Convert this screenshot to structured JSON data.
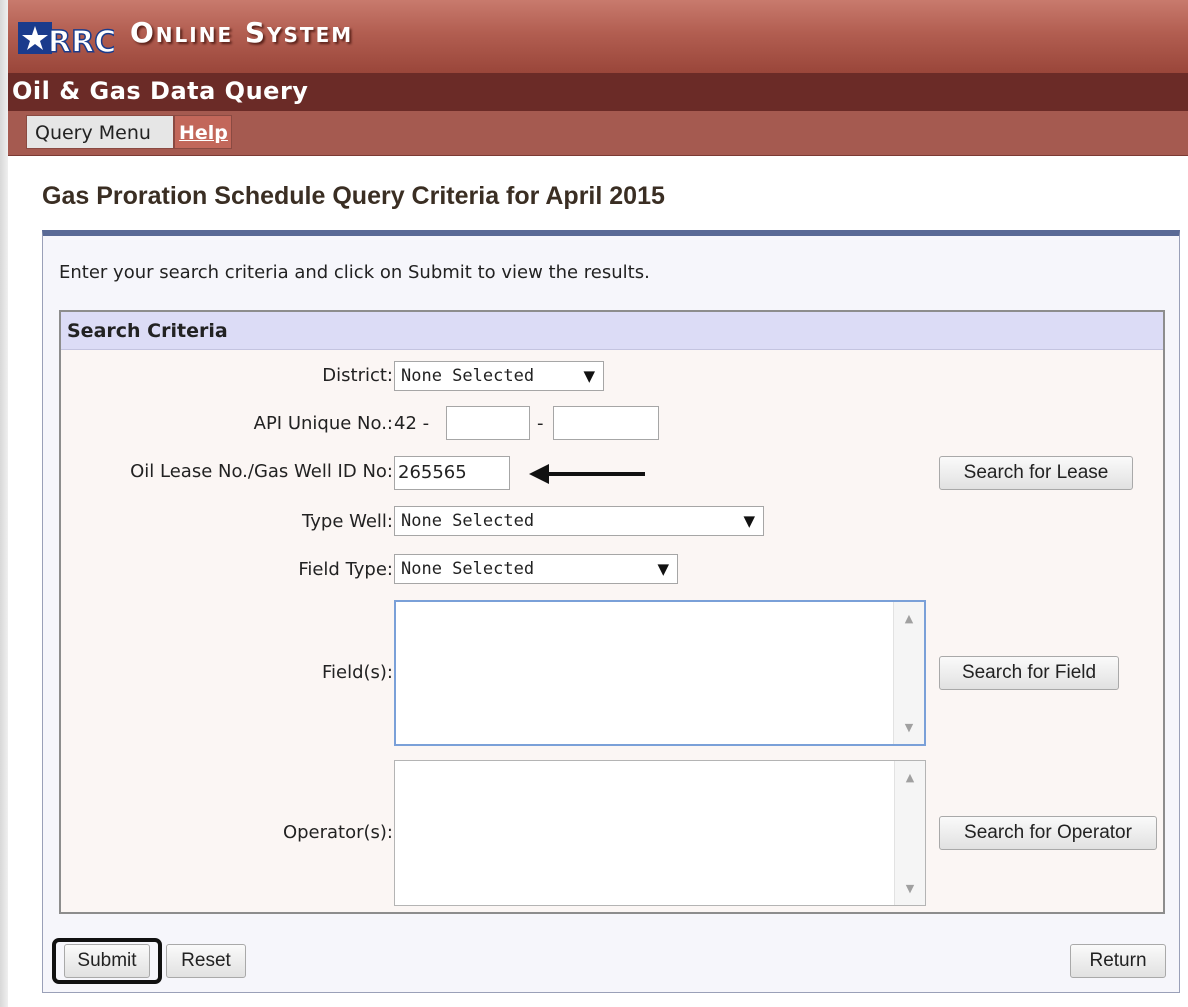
{
  "header": {
    "logo_text": "RRC",
    "system_title": "Online System",
    "subtitle": "Oil & Gas Data Query"
  },
  "menu": {
    "items": [
      {
        "label": "Query Menu"
      },
      {
        "label": "Help"
      }
    ]
  },
  "page": {
    "title": "Gas Proration Schedule Query Criteria for April 2015",
    "instruction": "Enter your search criteria and click on Submit to view the results."
  },
  "criteria": {
    "heading": "Search Criteria",
    "district": {
      "label": "District:",
      "value": "None Selected"
    },
    "api": {
      "label": "API Unique No.:",
      "prefix": "42 -",
      "separator": "-",
      "part1": "",
      "part2": ""
    },
    "lease": {
      "label": "Oil Lease No./Gas Well ID No:",
      "value": "265565",
      "button": "Search for Lease"
    },
    "type_well": {
      "label": "Type Well:",
      "value": "None Selected"
    },
    "field_type": {
      "label": "Field Type:",
      "value": "None Selected"
    },
    "fields": {
      "label": "Field(s):",
      "button": "Search for Field"
    },
    "operators": {
      "label": "Operator(s):",
      "button": "Search for Operator"
    }
  },
  "actions": {
    "submit": "Submit",
    "reset": "Reset",
    "return": "Return"
  },
  "colors": {
    "header_red": "#b25e51",
    "subheader": "#6b2b27",
    "panel_border": "#5a6a96",
    "criteria_head": "#dcdcf6"
  }
}
